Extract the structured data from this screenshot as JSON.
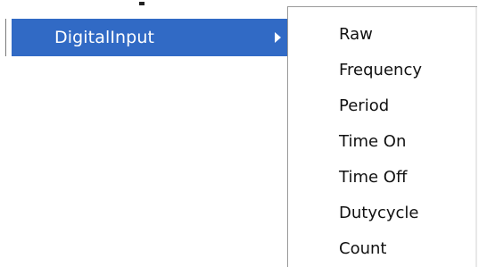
{
  "parent_menu": {
    "selected_item": {
      "label": "DigitalInput",
      "arrow_icon": "submenu-arrow-right-icon"
    },
    "highlight_color": "#316ac5"
  },
  "submenu": {
    "items": [
      {
        "label": "Raw"
      },
      {
        "label": "Frequency"
      },
      {
        "label": "Period"
      },
      {
        "label": "Time On"
      },
      {
        "label": "Time Off"
      },
      {
        "label": "Dutycycle"
      },
      {
        "label": "Count"
      }
    ]
  }
}
